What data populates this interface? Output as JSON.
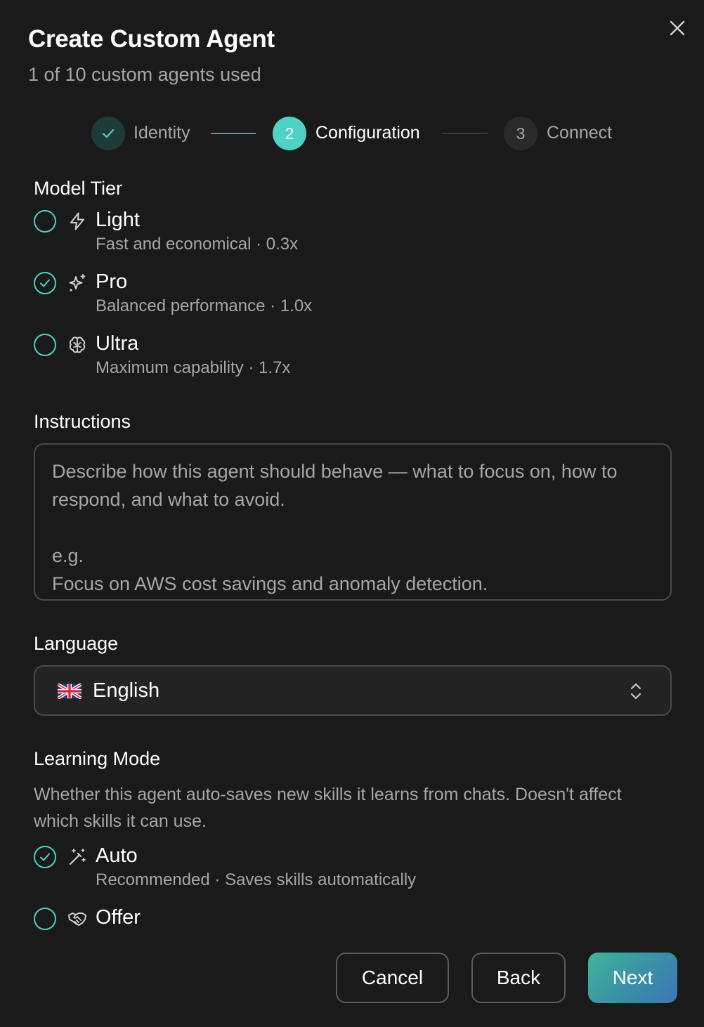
{
  "dialog": {
    "title": "Create Custom Agent",
    "subtitle": "1 of 10 custom agents used",
    "close_icon": "close-icon"
  },
  "stepper": {
    "steps": [
      {
        "marker": "check-icon",
        "label": "Identity",
        "state": "completed"
      },
      {
        "marker": "2",
        "label": "Configuration",
        "state": "active"
      },
      {
        "marker": "3",
        "label": "Connect",
        "state": "upcoming"
      }
    ],
    "accent": "#4fd1c5"
  },
  "model_tier": {
    "label": "Model Tier",
    "options": [
      {
        "icon": "lightning-icon",
        "title": "Light",
        "desc": "Fast and economical · 0.3x",
        "selected": false
      },
      {
        "icon": "sparkles-icon",
        "title": "Pro",
        "desc": "Balanced performance · 1.0x",
        "selected": true
      },
      {
        "icon": "brain-icon",
        "title": "Ultra",
        "desc": "Maximum capability · 1.7x",
        "selected": false
      }
    ]
  },
  "instructions": {
    "label": "Instructions",
    "value": "",
    "placeholder": "Describe how this agent should behave — what to focus on, how to respond, and what to avoid.\n\ne.g.\nFocus on AWS cost savings and anomaly detection."
  },
  "language": {
    "label": "Language",
    "flag_icon": "uk-flag-icon",
    "selected": "English"
  },
  "learning_mode": {
    "label": "Learning Mode",
    "description": "Whether this agent auto-saves new skills it learns from chats. Doesn't affect which skills it can use.",
    "options": [
      {
        "icon": "magic-wand-icon",
        "title": "Auto",
        "desc": "Recommended · Saves skills automatically",
        "selected": true
      },
      {
        "icon": "handshake-icon",
        "title": "Offer",
        "desc": "",
        "selected": false
      }
    ]
  },
  "footer": {
    "cancel_label": "Cancel",
    "back_label": "Back",
    "next_label": "Next"
  },
  "colors": {
    "background": "#1a1a1a",
    "accent": "#4fd1c5",
    "muted_text": "#a6a6a6",
    "border": "#4a4a4a"
  }
}
